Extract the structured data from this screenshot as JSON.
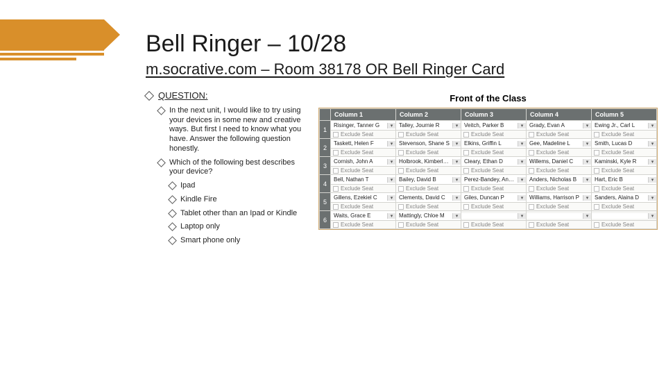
{
  "title": "Bell Ringer – 10/28",
  "subtitle": "m.socrative.com – Room 38178 OR Bell Ringer Card",
  "question_label": "QUESTION:",
  "prompt": "In the next unit, I would like to try using your devices in some new and creative ways.  But first I need to know what you have.  Answer the following question honestly.",
  "choice_lead": "Which of the following best describes your device?",
  "choices": [
    "Ipad",
    "Kindle Fire",
    "Tablet other than an Ipad or Kindle",
    "Laptop only",
    "Smart phone only"
  ],
  "front_label": "Front of the Class",
  "exclude_label": "Exclude Seat",
  "columns": [
    "Column 1",
    "Column 2",
    "Column 3",
    "Column 4",
    "Column 5"
  ],
  "rows": [
    [
      "Risinger, Tanner G",
      "Talley, Journie R",
      "Veitch, Parker B",
      "Grady, Evan A",
      "Ewing Jr., Carl L"
    ],
    [
      "Taskett, Helen F",
      "Stevenson, Shane S",
      "Elkins, Griffin L",
      "Gee, Madeline L",
      "Smith, Lucas D"
    ],
    [
      "Cornish, John A",
      "Holbrook, Kimberly H",
      "Cleary, Ethan D",
      "Willems, Daniel C",
      "Kaminski, Kyle R"
    ],
    [
      "Bell, Nathan T",
      "Bailey, David B",
      "Perez-Bandey, Andy J",
      "Anders, Nicholas B",
      "Hart, Eric B"
    ],
    [
      "Gillens, Ezekiel C",
      "Clements, David C",
      "Giles, Duncan P",
      "Williams, Harrison P",
      "Sanders, Alaina D"
    ],
    [
      "Waits, Grace E",
      "Mattingly, Chloe M",
      "",
      "",
      ""
    ]
  ]
}
